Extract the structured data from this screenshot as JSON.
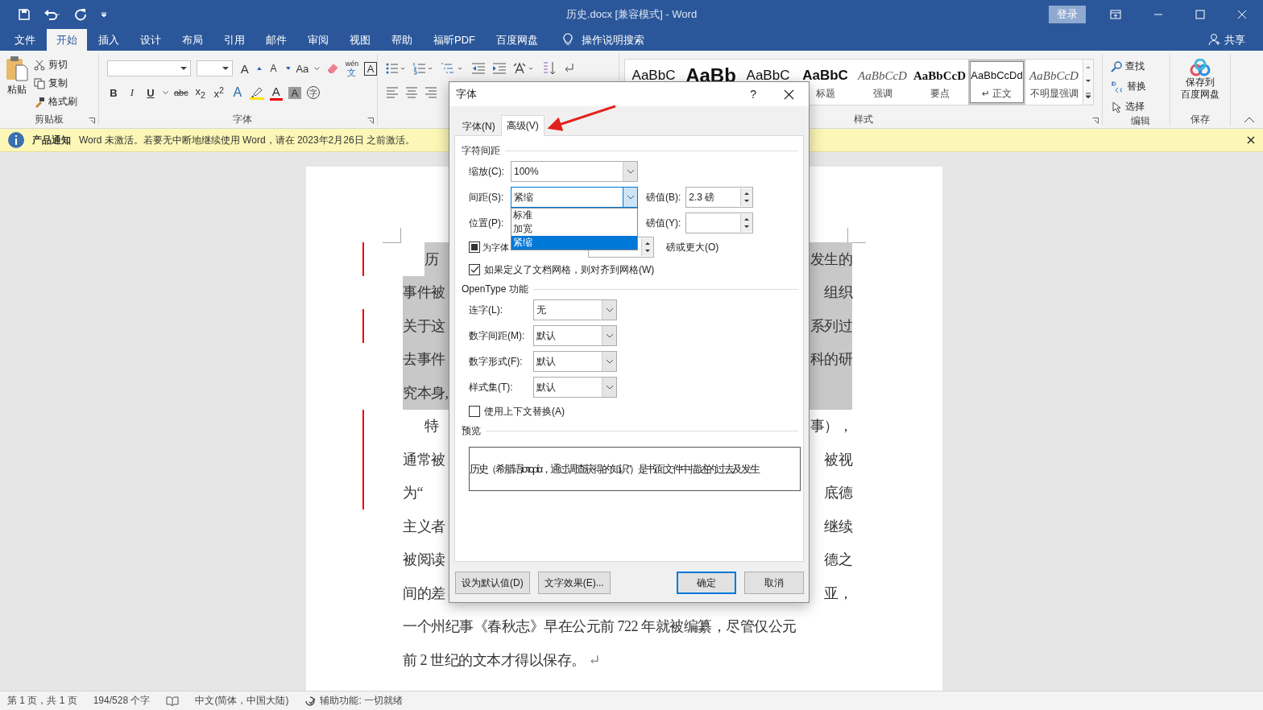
{
  "window": {
    "title": "历史.docx [兼容模式]  -  Word",
    "sign_in": "登录"
  },
  "ribbon_tabs": [
    {
      "label": "文件",
      "selected": false
    },
    {
      "label": "开始",
      "selected": true
    },
    {
      "label": "插入",
      "selected": false
    },
    {
      "label": "设计",
      "selected": false
    },
    {
      "label": "布局",
      "selected": false
    },
    {
      "label": "引用",
      "selected": false
    },
    {
      "label": "邮件",
      "selected": false
    },
    {
      "label": "审阅",
      "selected": false
    },
    {
      "label": "视图",
      "selected": false
    },
    {
      "label": "帮助",
      "selected": false
    },
    {
      "label": "福昕PDF",
      "selected": false
    },
    {
      "label": "百度网盘",
      "selected": false
    }
  ],
  "tell_me": "操作说明搜索",
  "share": "共享",
  "clipboard": {
    "paste": "粘贴",
    "cut": "剪切",
    "copy": "复制",
    "format_painter": "格式刷",
    "label": "剪贴板"
  },
  "font": {
    "label": "字体",
    "grow": "A",
    "shrink": "A",
    "change_case": "Aa",
    "phonetic_top": "wén",
    "phonetic_bottom": "文",
    "border": "A",
    "bold": "B",
    "italic": "I",
    "underline": "U",
    "strikethrough": "abc",
    "subscript": "x$_{2}$",
    "superscript": "x$^{2}$",
    "effects": "A",
    "color_letter": "A",
    "shading": "A",
    "enclose": "字"
  },
  "styles": {
    "label": "样式",
    "items": [
      {
        "sample": "AaBbC",
        "kind": "regular",
        "selected": false
      },
      {
        "sample": "AaBb",
        "kind": "heading",
        "selected": false
      },
      {
        "sample": "AaBbC",
        "kind": "regular",
        "selected": false
      },
      {
        "sample": "AaBbC",
        "kind": "bold",
        "label": "标题",
        "selected": false
      },
      {
        "sample": "AaBbCcD",
        "kind": "italic",
        "label": "强调",
        "selected": false
      },
      {
        "sample": "AaBbCcD",
        "kind": "serif-bold",
        "label": "要点",
        "selected": false
      },
      {
        "sample": "AaBbCcDd",
        "kind": "regular",
        "label": "↵ 正文",
        "selected": true
      },
      {
        "sample": "AaBbCcD",
        "kind": "italic",
        "label": "不明显强调",
        "selected": false
      }
    ]
  },
  "editing": {
    "find": "查找",
    "replace": "替换",
    "select": "选择",
    "label": "编辑"
  },
  "baidu": {
    "save_lines": [
      "保存到",
      "百度网盘"
    ],
    "label": "保存"
  },
  "notice": {
    "title": "产品通知",
    "message": "Word 未激活。若要无中断地继续使用 Word，请在 2023年2月26日 之前激活。"
  },
  "document": {
    "lines": [
      {
        "left": "历",
        "right": "发生的",
        "indent": true,
        "highlighted": true,
        "changed": true
      },
      {
        "left": "事件被",
        "right": "组织",
        "indent": false,
        "highlighted": true,
        "changed": false
      },
      {
        "left": "关于这",
        "right": "系列过",
        "indent": false,
        "highlighted": true,
        "changed": true
      },
      {
        "left": "去事件",
        "right": "科的研",
        "indent": false,
        "highlighted": true,
        "changed": false
      },
      {
        "left": "究本身,",
        "indent": false,
        "highlighted": true,
        "changed": false
      },
      {
        "left": "特",
        "right": "事），",
        "indent": true,
        "highlighted": false,
        "changed": true
      },
      {
        "left": "通常被",
        "right": "被视",
        "indent": false,
        "highlighted": false,
        "changed": true
      },
      {
        "left": "为“",
        "right": "底德",
        "indent": false,
        "highlighted": false,
        "changed": true
      },
      {
        "left": "主义者",
        "right": "继续",
        "indent": false,
        "highlighted": false,
        "changed": false
      },
      {
        "left": "被阅读",
        "right": "德之",
        "indent": false,
        "highlighted": false,
        "changed": false
      },
      {
        "left": "间的差",
        "right": "亚，",
        "indent": false,
        "highlighted": false,
        "changed": false
      },
      {
        "left": "一个州纪事《春秋志》早在公元前 722 年就被编纂，尽管仅公元",
        "indent": false,
        "highlighted": false,
        "changed": false
      },
      {
        "left": "前 2 世纪的文本才得以保存。",
        "paragraph_mark": "↵",
        "indent": false,
        "highlighted": false,
        "changed": false
      }
    ]
  },
  "dialog": {
    "title": "字体",
    "help": "?",
    "tabs": [
      {
        "label": "字体(N)",
        "selected": false
      },
      {
        "label": "高级(V)",
        "selected": true
      }
    ],
    "spacing_header": "字符间距",
    "scale": {
      "label": "缩放(C):",
      "value": "100%"
    },
    "spacing": {
      "label": "间距(S):",
      "value": "紧缩",
      "expanded": true,
      "by_label": "磅值(B):",
      "by_value": "2.3 磅",
      "options": [
        {
          "label": "标准",
          "selected": false
        },
        {
          "label": "加宽",
          "selected": false
        },
        {
          "label": "紧缩",
          "selected": true
        }
      ]
    },
    "position": {
      "label": "位置(P):",
      "by_label": "磅值(Y):"
    },
    "kerning": {
      "label": "为字体",
      "indeterminate": true,
      "suffix": "磅或更大(O)"
    },
    "snap_grid": {
      "label": "如果定义了文档网格，则对齐到网格(W)",
      "checked": true
    },
    "opentype_header": "OpenType 功能",
    "opentype": [
      {
        "label": "连字(L):",
        "value": "无"
      },
      {
        "label": "数字间距(M):",
        "value": "默认"
      },
      {
        "label": "数字形式(F):",
        "value": "默认"
      },
      {
        "label": "样式集(T):",
        "value": "默认"
      }
    ],
    "contextual": {
      "label": "使用上下文替换(A)",
      "checked": false
    },
    "preview_header": "预览",
    "preview_text": "历史（希腊语ἱστορία，通过调查获得的知识”）是书面文件中描述的过去及发生",
    "left_buttons": [
      {
        "label": "设为默认值(D)",
        "default": false
      },
      {
        "label": "文字效果(E)...",
        "default": false
      }
    ],
    "right_buttons": [
      {
        "label": "确定",
        "default": true
      },
      {
        "label": "取消",
        "default": false
      }
    ]
  },
  "status": {
    "page": "第 1 页，共 1 页",
    "words": "194/528 个字",
    "language": "中文(简体，中国大陆)",
    "accessibility": "辅助功能: 一切就绪"
  }
}
